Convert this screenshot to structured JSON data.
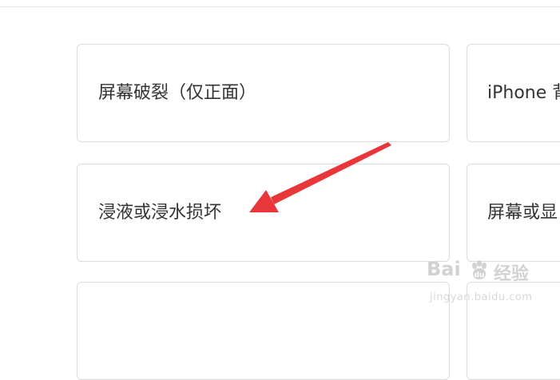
{
  "options": [
    {
      "label": "屏幕破裂（仅正面）"
    },
    {
      "label": "iPhone 背"
    },
    {
      "label": "浸液或浸水损坏"
    },
    {
      "label": "屏幕或显"
    },
    {
      "label": ""
    },
    {
      "label": ""
    }
  ],
  "annotation": {
    "arrow_color": "#e8363a"
  },
  "watermark": {
    "brand": "Bai",
    "brand_cn": "经验",
    "url": "jingyan.baidu.com",
    "color": "#d2d2d2"
  }
}
